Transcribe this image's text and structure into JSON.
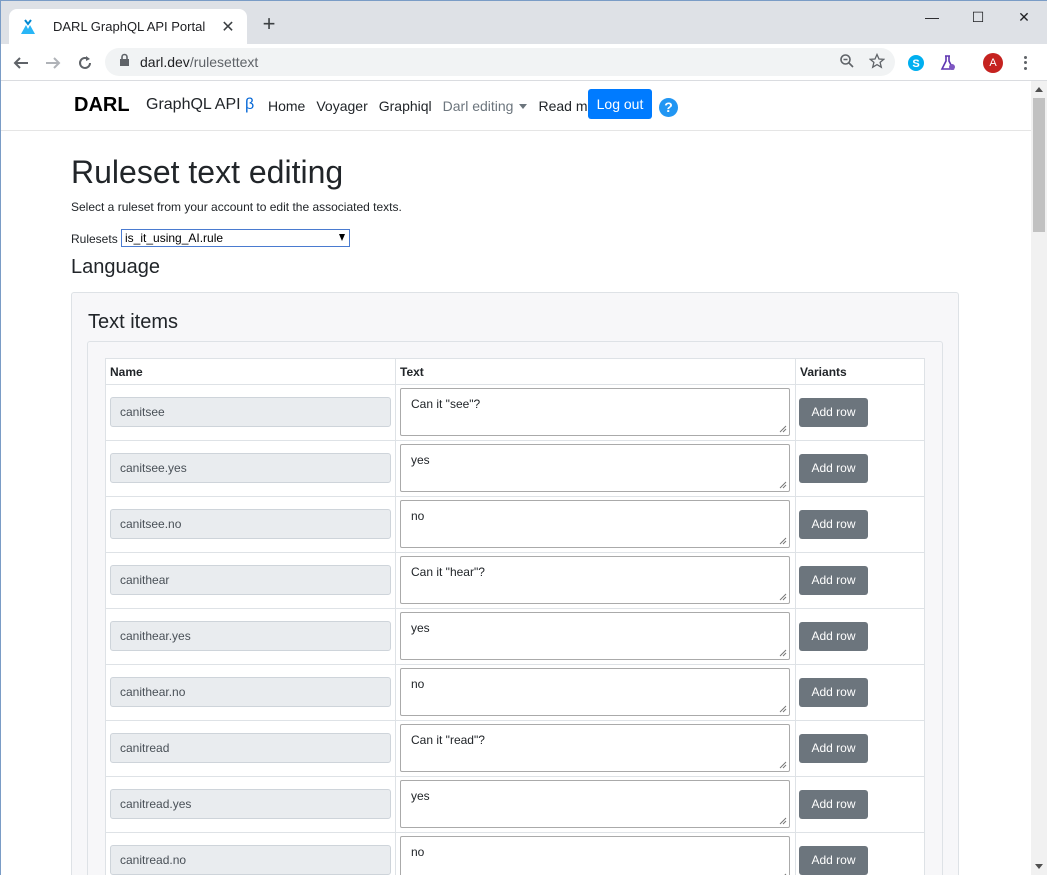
{
  "browser": {
    "tab_title": "DARL GraphQL API Portal",
    "url_domain": "darl.dev",
    "url_path": "/rulesettext",
    "profile_initial": "A"
  },
  "site": {
    "brand": "DARL",
    "subbrand": "GraphQL API",
    "beta_symbol": "β",
    "nav": [
      "Home",
      "Voyager",
      "Graphiql",
      "Darl editing",
      "Read me!"
    ],
    "logout_label": "Log out",
    "help_symbol": "?"
  },
  "page": {
    "title": "Ruleset text editing",
    "intro": "Select a ruleset from your account to edit the associated texts.",
    "rulesets_label": "Rulesets",
    "selected_ruleset": "is_it_using_AI.rule",
    "language_heading": "Language",
    "text_items_heading": "Text items"
  },
  "table": {
    "headers": [
      "Name",
      "Text",
      "Variants"
    ],
    "add_row_label": "Add row",
    "rows": [
      {
        "name": "canitsee",
        "text": "Can it \"see\"?"
      },
      {
        "name": "canitsee.yes",
        "text": "yes"
      },
      {
        "name": "canitsee.no",
        "text": "no"
      },
      {
        "name": "canithear",
        "text": "Can it \"hear\"?"
      },
      {
        "name": "canithear.yes",
        "text": "yes"
      },
      {
        "name": "canithear.no",
        "text": "no"
      },
      {
        "name": "canitread",
        "text": "Can it \"read\"?"
      },
      {
        "name": "canitread.yes",
        "text": "yes"
      },
      {
        "name": "canitread.no",
        "text": "no"
      }
    ]
  },
  "colors": {
    "primary": "#007bff",
    "secondary": "#6c757d",
    "help": "#2196f3"
  }
}
